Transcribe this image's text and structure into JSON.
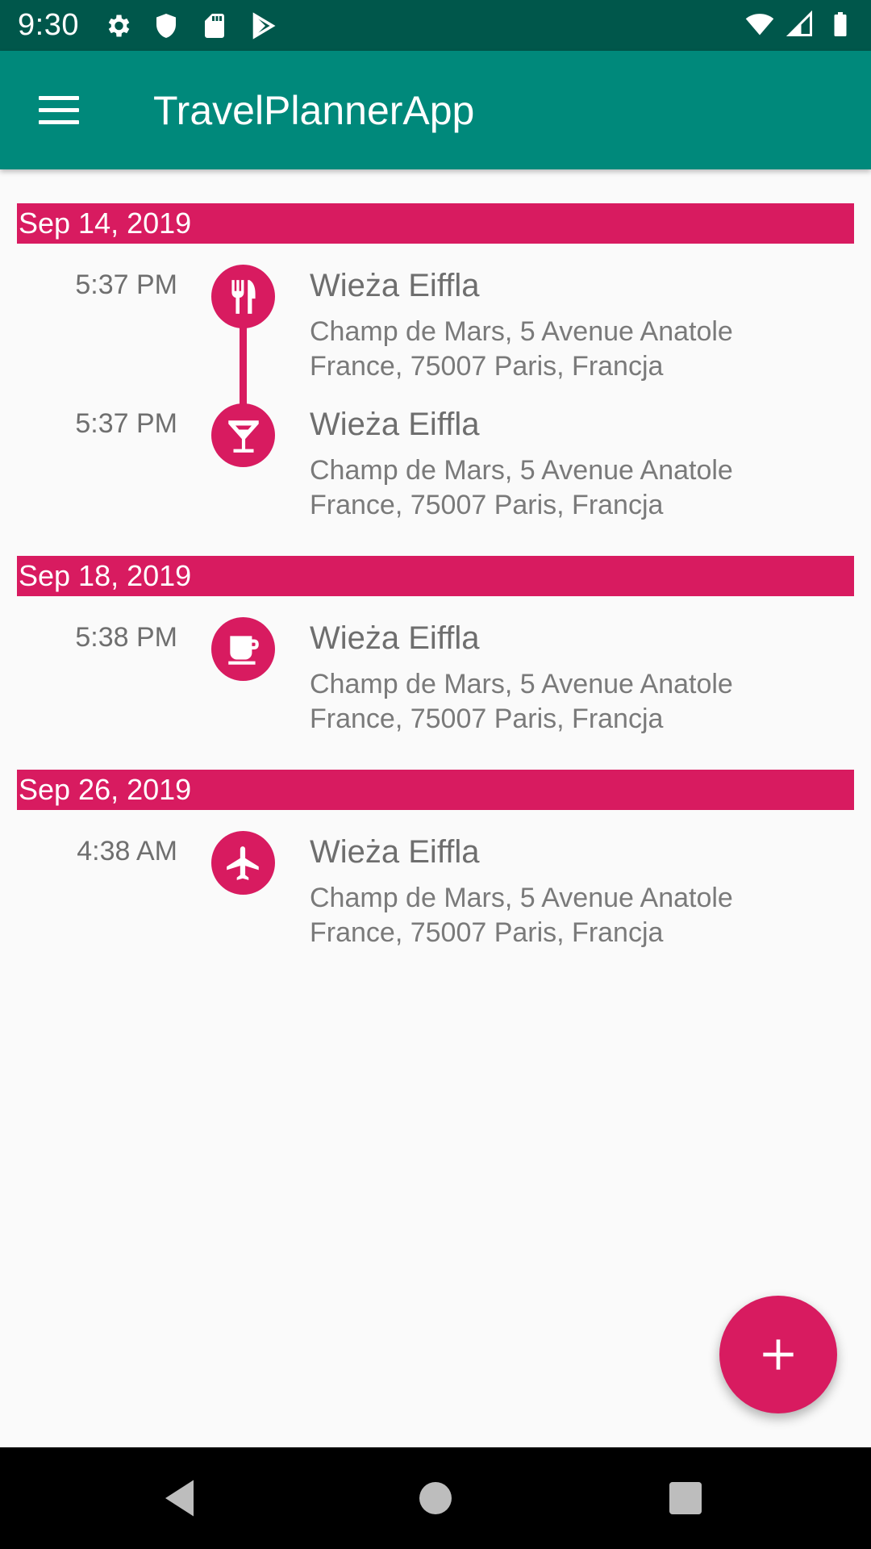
{
  "status_bar": {
    "time": "9:30",
    "left_icons": [
      "gear-icon",
      "shield-icon",
      "sd-card-icon",
      "play-store-icon"
    ],
    "right_icons": [
      "wifi-icon",
      "signal-icon",
      "battery-icon"
    ]
  },
  "app_bar": {
    "title": "TravelPlannerApp",
    "menu_icon": "hamburger-menu-icon"
  },
  "sections": [
    {
      "date": "Sep 14, 2019",
      "events": [
        {
          "time": "5:37 PM",
          "icon": "restaurant-icon",
          "title": "Wieża Eiffla",
          "address": "Champ de Mars, 5 Avenue Anatole France, 75007 Paris, Francja"
        },
        {
          "time": "5:37 PM",
          "icon": "cocktail-icon",
          "title": "Wieża Eiffla",
          "address": "Champ de Mars, 5 Avenue Anatole France, 75007 Paris, Francja"
        }
      ]
    },
    {
      "date": "Sep 18, 2019",
      "events": [
        {
          "time": "5:38 PM",
          "icon": "coffee-cup-icon",
          "title": "Wieża Eiffla",
          "address": "Champ de Mars, 5 Avenue Anatole France, 75007 Paris, Francja"
        }
      ]
    },
    {
      "date": "Sep 26, 2019",
      "events": [
        {
          "time": "4:38 AM",
          "icon": "airplane-icon",
          "title": "Wieża Eiffla",
          "address": "Champ de Mars, 5 Avenue Anatole France, 75007 Paris, Francja"
        }
      ]
    }
  ],
  "fab": {
    "icon": "plus-icon"
  },
  "nav_bar": {
    "buttons": [
      "back-icon",
      "home-icon",
      "recents-icon"
    ]
  },
  "colors": {
    "status_bar": "#00574b",
    "app_bar": "#00897b",
    "accent": "#d81b60",
    "background": "#fafafa"
  }
}
